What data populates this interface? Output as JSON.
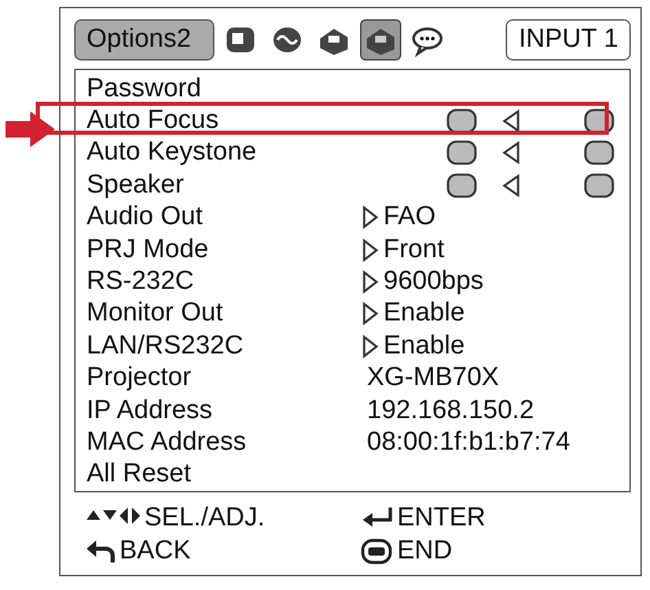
{
  "menu": {
    "title": "Options2",
    "input": "INPUT 1"
  },
  "tabs": [
    {
      "selected": false
    },
    {
      "selected": false
    },
    {
      "selected": false
    },
    {
      "selected": true
    },
    {
      "selected": false
    }
  ],
  "items": [
    {
      "kind": "plain",
      "label": "Password",
      "highlighted": false
    },
    {
      "kind": "toggle",
      "label": "Auto Focus",
      "highlighted": true
    },
    {
      "kind": "toggle",
      "label": "Auto Keystone",
      "highlighted": false
    },
    {
      "kind": "toggle",
      "label": "Speaker",
      "highlighted": false
    },
    {
      "kind": "option",
      "label": "Audio Out",
      "value": "FAO",
      "highlighted": false
    },
    {
      "kind": "option",
      "label": "PRJ Mode",
      "value": "Front",
      "highlighted": false
    },
    {
      "kind": "option",
      "label": "RS-232C",
      "value": "9600bps",
      "highlighted": false
    },
    {
      "kind": "option",
      "label": "Monitor Out",
      "value": "Enable",
      "highlighted": false
    },
    {
      "kind": "option",
      "label": "LAN/RS232C",
      "value": "Enable",
      "highlighted": false
    },
    {
      "kind": "info",
      "label": "Projector",
      "value": "XG-MB70X",
      "highlighted": false
    },
    {
      "kind": "info",
      "label": "IP Address",
      "value": "192.168.150.2",
      "highlighted": false
    },
    {
      "kind": "info",
      "label": "MAC Address",
      "value": "08:00:1f:b1:b7:74",
      "highlighted": false
    },
    {
      "kind": "plain",
      "label": "All Reset",
      "highlighted": false
    }
  ],
  "footer": [
    {
      "kind": "arrows",
      "label": "SEL./ADJ."
    },
    {
      "kind": "enter",
      "label": "ENTER"
    },
    {
      "kind": "back",
      "label": "BACK"
    },
    {
      "kind": "end",
      "label": "END"
    }
  ]
}
